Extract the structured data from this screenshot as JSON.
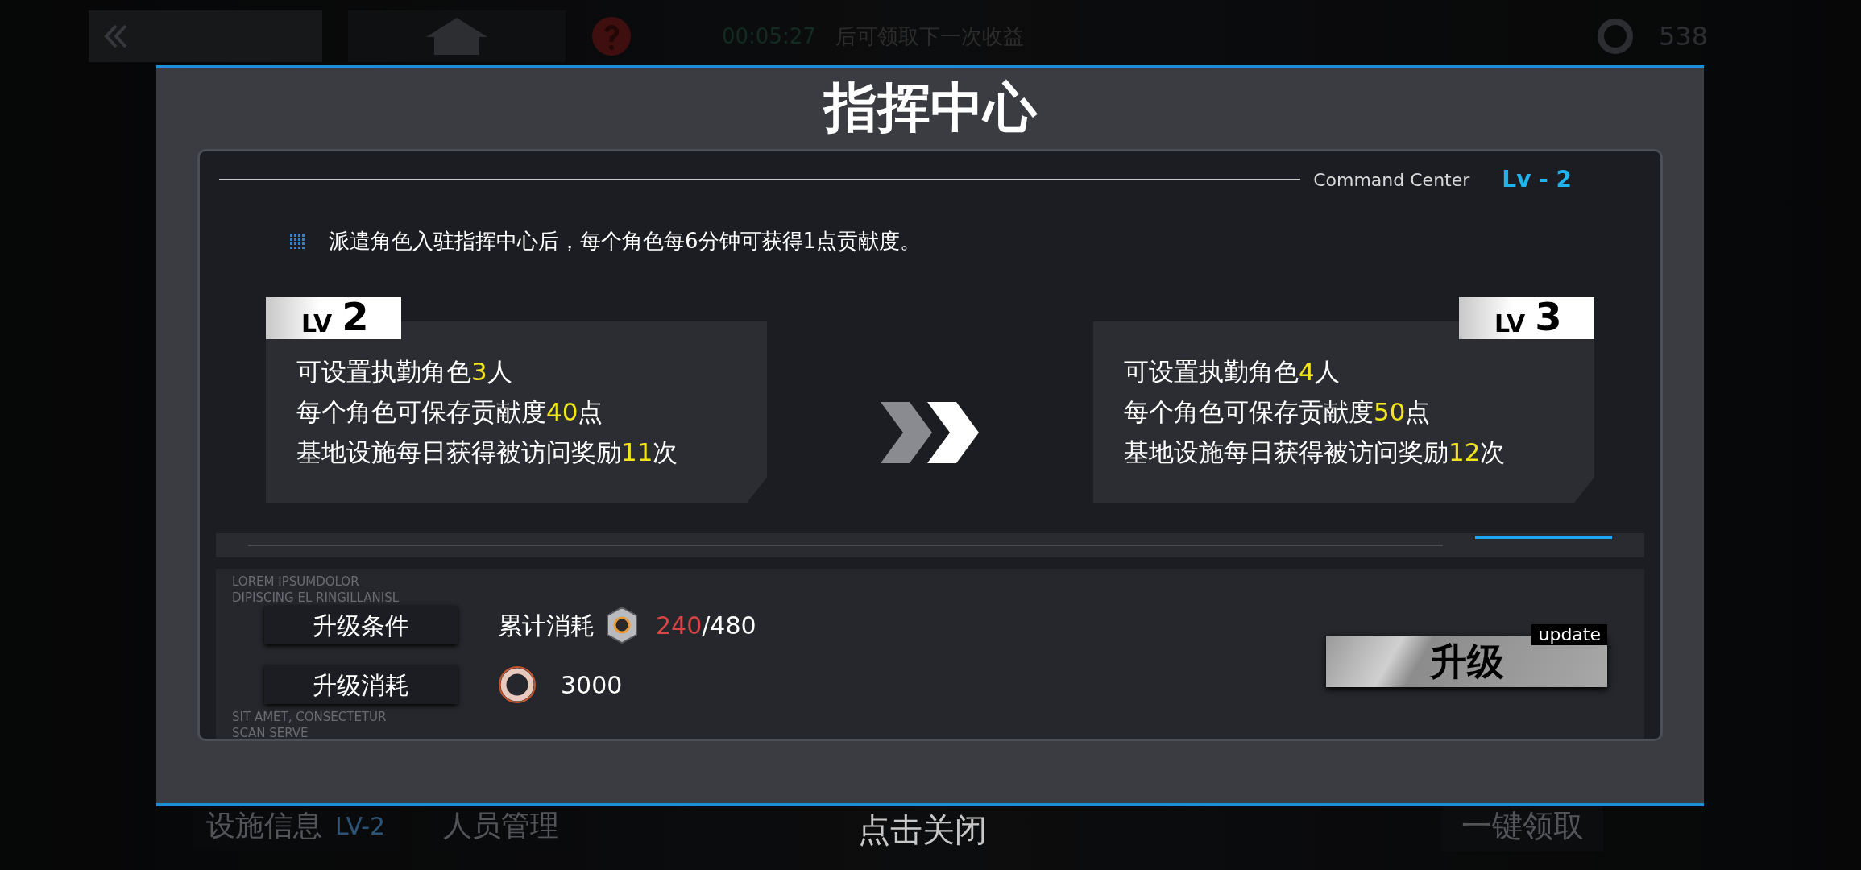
{
  "background_hud": {
    "timer": "00:05:27",
    "timer_caption": "后可领取下一次收益",
    "currency": "538",
    "tabs": [
      {
        "label": "设施信息",
        "badge": "LV-2"
      },
      {
        "label": "人员管理"
      }
    ],
    "claim_all": "一键领取"
  },
  "dialog": {
    "title": "指挥中心",
    "subtitle": "Command Center",
    "level": "Lv - 2",
    "description": "派遣角色入驻指挥中心后，每个角色每6分钟可获得1点贡献度。",
    "levels": [
      {
        "kind": "current",
        "tag": "LV",
        "number": "2",
        "lines": [
          "可设置执勤角色**3**人",
          "每个角色可保存贡献度**40**点",
          "基地设施每日获得被访问奖励**11**次"
        ]
      },
      {
        "kind": "next",
        "tag": "LV",
        "number": "3",
        "lines": [
          "可设置执勤角色**4**人",
          "每个角色可保存贡献度**50**点",
          "基地设施每日获得被访问奖励**12**次"
        ]
      }
    ],
    "deco_text": [
      "LOREM  IPSUMDOLOR",
      "DIPISCING EL  RINGILLANISL",
      "SIT AMET, CONSECTETUR",
      "SCAN SERVE"
    ],
    "requirements": [
      {
        "kind": "condition",
        "label": "升级条件",
        "caption": "累计消耗",
        "have": "240",
        "need": "/480"
      },
      {
        "kind": "cost",
        "label": "升级消耗",
        "amount": "3000"
      }
    ],
    "upgrade_button": {
      "label": "升级",
      "tag": "update"
    }
  },
  "dismiss_hint": "点击关闭"
}
